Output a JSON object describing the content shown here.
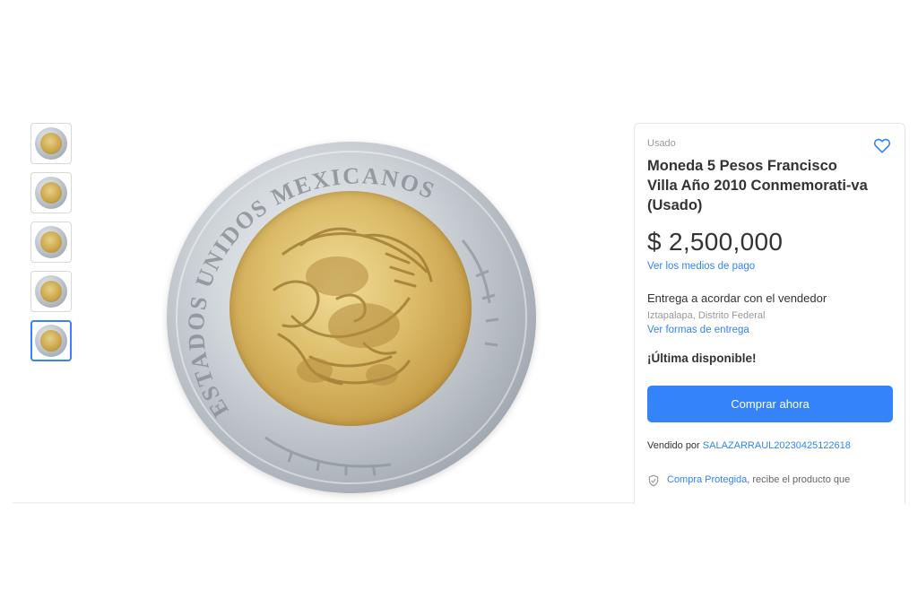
{
  "gallery": {
    "thumbnail_count": 5,
    "active_index": 4
  },
  "product": {
    "condition": "Usado",
    "title": "Moneda 5 Pesos Francisco Villa Año 2010 Conmemorati-va (Usado)",
    "price": "$ 2,500,000",
    "payment_link": "Ver los medios de pago",
    "delivery": "Entrega a acordar con el vendedor",
    "location": "Iztapalapa, Distrito Federal",
    "delivery_link": "Ver formas de entrega",
    "stock_note": "¡Última disponible!",
    "buy_button": "Comprar ahora",
    "sold_by_label": "Vendido por",
    "seller_name": "SALAZARRAUL20230425122618",
    "protected_link": "Compra Protegida",
    "protected_text": ", recibe el producto que"
  },
  "coin": {
    "ring_legend": "ESTADOS UNIDOS MEXICANOS"
  },
  "colors": {
    "accent": "#3483fa",
    "text": "#333333",
    "muted": "#999999"
  },
  "icons": {
    "favorite": "heart-icon",
    "protected": "shield-check-icon"
  }
}
